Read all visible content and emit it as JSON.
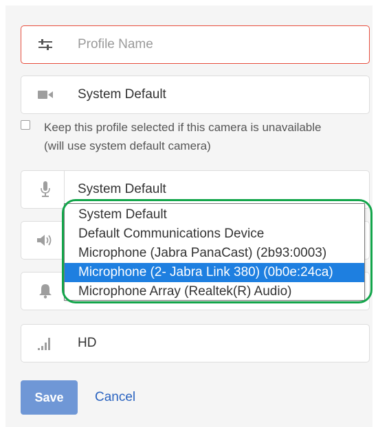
{
  "form": {
    "profile_name": {
      "placeholder": "Profile Name",
      "icon": "sliders-icon"
    },
    "camera": {
      "value": "System Default",
      "icon": "video-camera-icon"
    },
    "keep_profile_checkbox": {
      "checked": false,
      "line1": "Keep this profile selected if this camera is unavailable",
      "line2": "(will use system default camera)"
    },
    "microphone": {
      "value": "System Default",
      "icon": "microphone-icon",
      "options": [
        "System Default",
        "Default Communications Device",
        "Microphone (Jabra PanaCast) (2b93:0003)",
        "Microphone (2- Jabra Link 380) (0b0e:24ca)",
        "Microphone Array (Realtek(R) Audio)"
      ],
      "highlighted_index": 3
    },
    "speaker": {
      "icon": "speaker-icon"
    },
    "alert": {
      "icon": "bell-icon"
    },
    "quality": {
      "value": "HD",
      "icon": "signal-bars-icon"
    }
  },
  "actions": {
    "save_label": "Save",
    "cancel_label": "Cancel"
  },
  "colors": {
    "error_border": "#e74c3c",
    "highlight": "#1e7fe0",
    "annotation_ring": "#12a54a",
    "save_button": "#6f97d6",
    "link": "#2a63c0"
  }
}
